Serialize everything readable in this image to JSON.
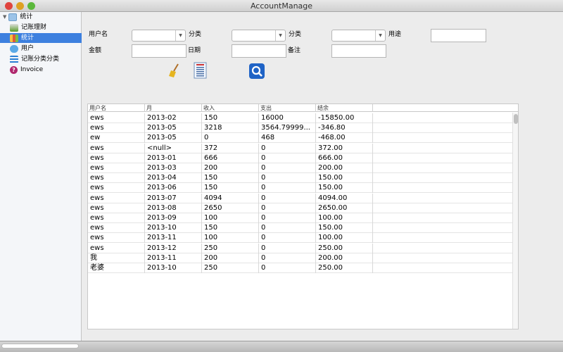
{
  "window": {
    "title": "AccountManage"
  },
  "sidebar": {
    "group": "统计",
    "items": [
      {
        "label": "记账理财",
        "icon": "ledger-icon",
        "selected": false
      },
      {
        "label": "统计",
        "icon": "chart-icon",
        "selected": true
      },
      {
        "label": "用户",
        "icon": "users-icon",
        "selected": false
      },
      {
        "label": "记账分类分类",
        "icon": "list-icon",
        "selected": false
      },
      {
        "label": "Invoice",
        "icon": "help-icon",
        "selected": false
      }
    ]
  },
  "filters": {
    "username": "用户名",
    "category1": "分类",
    "category2": "分类",
    "purpose": "用途",
    "amount": "金额",
    "date": "日期",
    "note": "备注"
  },
  "table": {
    "columns": [
      "用户名",
      "月",
      "收入",
      "支出",
      "结余"
    ],
    "rows": [
      [
        "ews",
        "2013-02",
        "150",
        "16000",
        "-15850.00"
      ],
      [
        "ews",
        "2013-05",
        "3218",
        "3564.79999...",
        "-346.80"
      ],
      [
        "ew",
        "2013-05",
        "0",
        "468",
        "-468.00"
      ],
      [
        "ews",
        "<null>",
        "372",
        "0",
        "372.00"
      ],
      [
        "ews",
        "2013-01",
        "666",
        "0",
        "666.00"
      ],
      [
        "ews",
        "2013-03",
        "200",
        "0",
        "200.00"
      ],
      [
        "ews",
        "2013-04",
        "150",
        "0",
        "150.00"
      ],
      [
        "ews",
        "2013-06",
        "150",
        "0",
        "150.00"
      ],
      [
        "ews",
        "2013-07",
        "4094",
        "0",
        "4094.00"
      ],
      [
        "ews",
        "2013-08",
        "2650",
        "0",
        "2650.00"
      ],
      [
        "ews",
        "2013-09",
        "100",
        "0",
        "100.00"
      ],
      [
        "ews",
        "2013-10",
        "150",
        "0",
        "150.00"
      ],
      [
        "ews",
        "2013-11",
        "100",
        "0",
        "100.00"
      ],
      [
        "ews",
        "2013-12",
        "250",
        "0",
        "250.00"
      ],
      [
        "我",
        "2013-11",
        "200",
        "0",
        "200.00"
      ],
      [
        "老婆",
        "2013-10",
        "250",
        "0",
        "250.00"
      ]
    ]
  }
}
